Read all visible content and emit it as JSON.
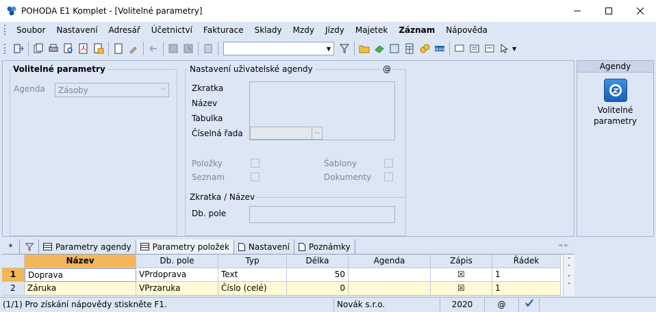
{
  "window": {
    "title": "POHODA E1 Komplet - [Volitelné parametry]"
  },
  "menu": [
    "Soubor",
    "Nastavení",
    "Adresář",
    "Účetnictví",
    "Fakturace",
    "Sklady",
    "Mzdy",
    "Jízdy",
    "Majetek",
    "Záznam",
    "Nápověda"
  ],
  "toolbar": {
    "search_value": ""
  },
  "left_group": {
    "title": "Volitelné parametry",
    "agenda_label": "Agenda",
    "agenda_value": "Zásoby"
  },
  "user_agenda": {
    "title": "Nastavení uživatelské agendy",
    "at_symbol": "@",
    "zkratka_label": "Zkratka",
    "nazev_label": "Název",
    "tabulka_label": "Tabulka",
    "rada_label": "Číselná řada",
    "rada_button": "...",
    "polozky_label": "Položky",
    "seznam_label": "Seznam",
    "sablony_label": "Šablony",
    "dokumenty_label": "Dokumenty",
    "zkratka_nazev_title": "Zkratka / Název",
    "dbpole_label": "Db. pole"
  },
  "side_panel": {
    "header": "Agendy",
    "item_line1": "Volitelné",
    "item_line2": "parametry"
  },
  "tabs": [
    "*",
    "",
    "Parametry agendy",
    "Parametry položek",
    "Nastavení",
    "Poznámky"
  ],
  "table": {
    "columns": [
      "Název",
      "Db. pole",
      "Typ",
      "Délka",
      "Agenda",
      "Zápis",
      "Řádek"
    ],
    "rows": [
      {
        "num": "1",
        "nazev": "Doprava",
        "dbpole": "VPrdoprava",
        "typ": "Text",
        "delka": "50",
        "agenda": "",
        "zapis": "☒",
        "radek": "1"
      },
      {
        "num": "2",
        "nazev": "Záruka",
        "dbpole": "VPrzaruka",
        "typ": "Číslo (celé)",
        "delka": "0",
        "agenda": "",
        "zapis": "☒",
        "radek": "1"
      }
    ]
  },
  "status": {
    "help": "(1/1) Pro získání nápovědy stiskněte F1.",
    "company": "Novák s.r.o.",
    "year": "2020",
    "at": "@"
  }
}
